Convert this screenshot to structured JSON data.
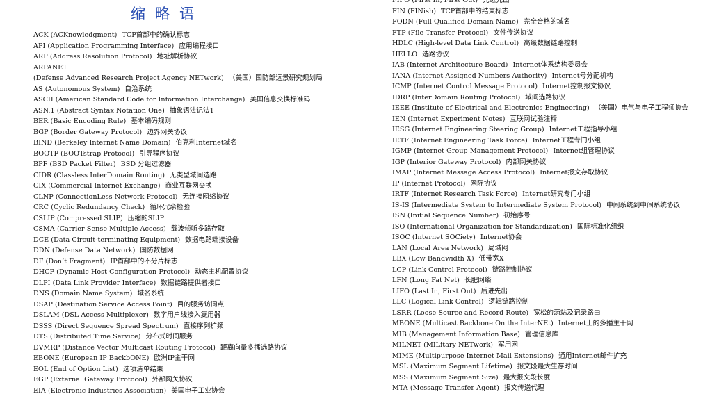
{
  "title": "缩略语",
  "left_entries": [
    {
      "en": "ACK (ACKnowledgment)",
      "zh": "TCP首部中的确认标志"
    },
    {
      "en": "API (Application Programming Interface)",
      "zh": "应用编程接口"
    },
    {
      "en": "ARP (Address Resolution Protocol)",
      "zh": "地址解析协议"
    },
    {
      "en": "ARPANET",
      "zh": ""
    },
    {
      "en": "(Defense Advanced Research Project Agency NETwork)",
      "zh": "（美国）国防部远景研究规划局"
    },
    {
      "en": "AS (Autonomous System)",
      "zh": "自治系统"
    },
    {
      "en": "ASCII (American Standard Code for Information Interchange)",
      "zh": "美国信息交换标准码"
    },
    {
      "en": "ASN.1 (Abstract Syntax Notation One)",
      "zh": "抽象语法记法1"
    },
    {
      "en": "BER (Basic Encoding Rule)",
      "zh": "基本编码规则"
    },
    {
      "en": "BGP (Border Gateway Protocol)",
      "zh": "边界网关协议"
    },
    {
      "en": "BIND (Berkeley Internet Name Domain)",
      "zh": "伯克利Internet域名"
    },
    {
      "en": "BOOTP (BOOTstrap Protocol)",
      "zh": "引导程序协议"
    },
    {
      "en": "BPF (BSD Packet Filter)",
      "zh": "BSD 分组过滤器"
    },
    {
      "en": "CIDR (Classless InterDomain Routing)",
      "zh": "无类型域间选路"
    },
    {
      "en": "CIX (Commercial Internet Exchange)",
      "zh": "商业互联网交换"
    },
    {
      "en": "CLNP (ConnectionLess Network Protocol)",
      "zh": "无连接网络协议"
    },
    {
      "en": "CRC (Cyclic Redundancy Check)",
      "zh": "循环冗余检验"
    },
    {
      "en": "CSLIP (Compressed SLIP)",
      "zh": "压缩的SLIP"
    },
    {
      "en": "CSMA (Carrier Sense Multiple Access)",
      "zh": "载波侦听多路存取"
    },
    {
      "en": "DCE (Data Circuit-terminating Equipment)",
      "zh": "数据电路端接设备"
    },
    {
      "en": "DDN (Defense Data Network)",
      "zh": "国防数据网"
    },
    {
      "en": "DF (Don’t Fragment)",
      "zh": "IP首部中的不分片标志"
    },
    {
      "en": "DHCP (Dynamic Host Configuration Protocol)",
      "zh": "动态主机配置协议"
    },
    {
      "en": "DLPI (Data Link Provider Interface)",
      "zh": "数据链路提供者接口"
    },
    {
      "en": "DNS (Domain Name System)",
      "zh": "域名系统"
    },
    {
      "en": "DSAP (Destination Service Access Point)",
      "zh": "目的服务访问点"
    },
    {
      "en": "DSLAM (DSL Access Multiplexer)",
      "zh": "数字用户线接入复用器"
    },
    {
      "en": "DSSS (Direct Sequence Spread Spectrum)",
      "zh": "直接序列扩频"
    },
    {
      "en": "DTS (Distributed Time Service)",
      "zh": "分布式时间服务"
    },
    {
      "en": "DVMRP (Distance Vector Multicast Routing Protocol)",
      "zh": "距离向量多播选路协议"
    },
    {
      "en": "EBONE (European IP BackbONE)",
      "zh": "欧洲IP主干网"
    },
    {
      "en": "EOL (End of Option List)",
      "zh": "选项清单结束"
    },
    {
      "en": "EGP (External Gateway Protocol)",
      "zh": "外部网关协议"
    },
    {
      "en": "EIA (Electronic Industries Association)",
      "zh": "美国电子工业协会"
    }
  ],
  "right_entries": [
    {
      "en": "FIFO (First In, First Out)",
      "zh": "先进先出"
    },
    {
      "en": "FIN (FINish)",
      "zh": "TCP首部中的结束标志"
    },
    {
      "en": "FQDN (Full Qualified Domain Name)",
      "zh": "完全合格的域名"
    },
    {
      "en": "FTP (File Transfer Protocol)",
      "zh": "文件传送协议"
    },
    {
      "en": "HDLC (High-level Data Link Control)",
      "zh": "高级数据链路控制"
    },
    {
      "en": "HELLO",
      "zh": "选路协议"
    },
    {
      "en": "IAB (Internet Architecture Board)",
      "zh": "Internet体系结构委员会"
    },
    {
      "en": "IANA (Internet Assigned Numbers Authority)",
      "zh": "Internet号分配机构"
    },
    {
      "en": "ICMP (Internet Control Message Protocol)",
      "zh": "Internet控制报文协议"
    },
    {
      "en": "IDRP (InterDomain Routing Protocol)",
      "zh": "域间选路协议"
    },
    {
      "en": "IEEE (Institute of Electrical and Electronics Engineering)",
      "zh": "（美国）电气与电子工程师协会"
    },
    {
      "en": "IEN (Internet Experiment Notes)",
      "zh": "互联网试验注释"
    },
    {
      "en": "IESG (Internet Engineering Steering Group)",
      "zh": "Internet工程指导小组"
    },
    {
      "en": "IETF (Internet Engineering Task Force)",
      "zh": "Internet工程专门小组"
    },
    {
      "en": "IGMP (Internet Group Management Protocol)",
      "zh": "Internet组管理协议"
    },
    {
      "en": "IGP (Interior Gateway Protocol)",
      "zh": "内部网关协议"
    },
    {
      "en": "IMAP (Internet Message Access Protocol)",
      "zh": "Internet报文存取协议"
    },
    {
      "en": "IP (Internet Protocol)",
      "zh": "网际协议"
    },
    {
      "en": "IRTF (Internet Research Task Force)",
      "zh": "Internet研究专门小组"
    },
    {
      "en": "IS-IS (Intermediate System to Intermediate System Protocol)",
      "zh": "中间系统到中间系统协议"
    },
    {
      "en": "ISN (Initial Sequence Number)",
      "zh": "初始序号"
    },
    {
      "en": "ISO (International Organization for Standardization)",
      "zh": "国际标准化组织"
    },
    {
      "en": "ISOC (Internet SOCiety)",
      "zh": "Internet协会"
    },
    {
      "en": "LAN (Local Area Network)",
      "zh": "局域网"
    },
    {
      "en": "LBX (Low Bandwidth X)",
      "zh": "低带宽X"
    },
    {
      "en": "LCP (Link Control Protocol)",
      "zh": "链路控制协议"
    },
    {
      "en": "LFN (Long Fat Net)",
      "zh": "长肥网络"
    },
    {
      "en": "LIFO (Last In, First Out)",
      "zh": "后进先出"
    },
    {
      "en": "LLC (Logical Link Control)",
      "zh": "逻辑链路控制"
    },
    {
      "en": "LSRR (Loose Source and Record Route)",
      "zh": "宽松的源站及记录路由"
    },
    {
      "en": "MBONE (Multicast Backbone On the InterNEt)",
      "zh": "Internet上的多播主干网"
    },
    {
      "en": "MIB (Management Information Base)",
      "zh": "管理信息库"
    },
    {
      "en": "MILNET (MILitary NETwork)",
      "zh": "军用网"
    },
    {
      "en": "MIME (Multipurpose Internet Mail Extensions)",
      "zh": "通用Internet邮件扩充"
    },
    {
      "en": "MSL (Maximum Segment Lifetime)",
      "zh": "报文段最大生存时间"
    },
    {
      "en": "MSS (Maximum Segment Size)",
      "zh": "最大报文段长度"
    },
    {
      "en": "MTA (Message Transfer Agent)",
      "zh": "报文传送代理"
    }
  ]
}
